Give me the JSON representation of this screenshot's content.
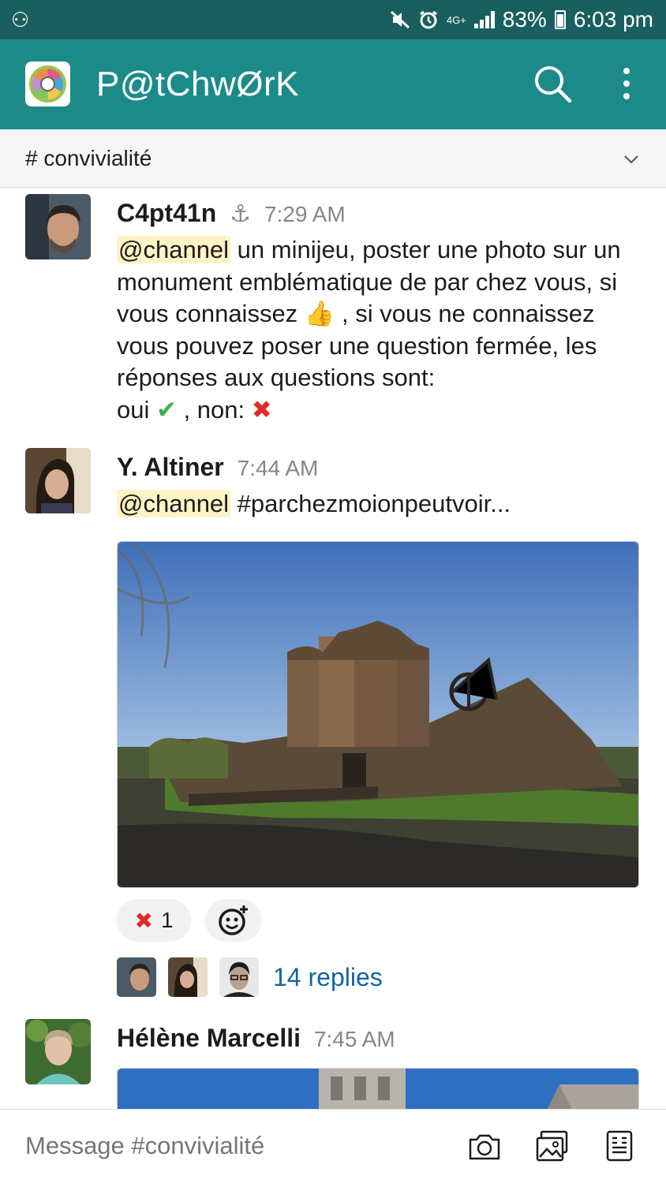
{
  "status_bar": {
    "network": "4G+",
    "battery": "83%",
    "time": "6:03 pm"
  },
  "app_bar": {
    "title": "P@tChwØrK"
  },
  "channel": {
    "name": "#  convivialité"
  },
  "messages": [
    {
      "author": "C4pt41n",
      "time": "7:29 AM",
      "mention": "@channel",
      "text_1": " un minijeu, poster une photo sur un monument emblématique de par chez vous, si vous connaissez ",
      "emoji_1": "👍",
      "text_2": " , si vous ne connaissez vous pouvez poser une question fermée, les réponses aux questions sont:",
      "text_3": " oui ",
      "emoji_2": "✔",
      "text_4": " , non: ",
      "emoji_3": "✖"
    },
    {
      "author": "Y. Altiner",
      "time": "7:44 AM",
      "mention": "@channel",
      "text": " #parchezmoionpeutvoir...",
      "reaction": {
        "emoji": "✖",
        "count": "1"
      },
      "replies": "14 replies"
    },
    {
      "author": "Hélène Marcelli",
      "time": "7:45 AM"
    }
  ],
  "composer": {
    "placeholder": "Message #convivialité"
  },
  "colors": {
    "status_bar": "#1a5f5f",
    "app_bar": "#1d8a8a",
    "link": "#1264a3",
    "mention_bg": "#fdf3c4"
  }
}
